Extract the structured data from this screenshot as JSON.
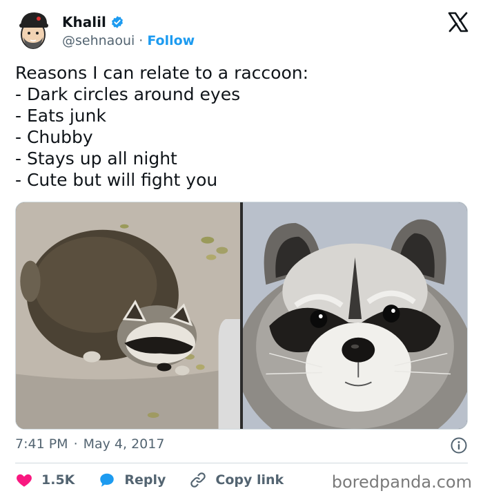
{
  "author": {
    "name": "Khalil",
    "handle": "@sehnaoui",
    "separator": "·",
    "follow_label": "Follow",
    "avatar_icon": "avatar-cartoon-man-cap",
    "verified_icon": "verified-badge-icon",
    "verified_color": "#1d9bf0"
  },
  "platform_icon": "x-logo-icon",
  "tweet": {
    "lines": [
      "Reasons I can relate to a raccoon:",
      "- Dark circles around eyes",
      "- Eats junk",
      "- Chubby",
      "- Stays up all night",
      "- Cute but will fight you"
    ]
  },
  "meta": {
    "time": "7:41 PM",
    "separator": "·",
    "date": "May 4, 2017",
    "info_icon": "info-icon"
  },
  "actions": {
    "likes": "1.5K",
    "reply_label": "Reply",
    "copy_link_label": "Copy link",
    "heart_color": "#f91880",
    "reply_color": "#1d9bf0"
  },
  "watermark": "boredpanda.com"
}
